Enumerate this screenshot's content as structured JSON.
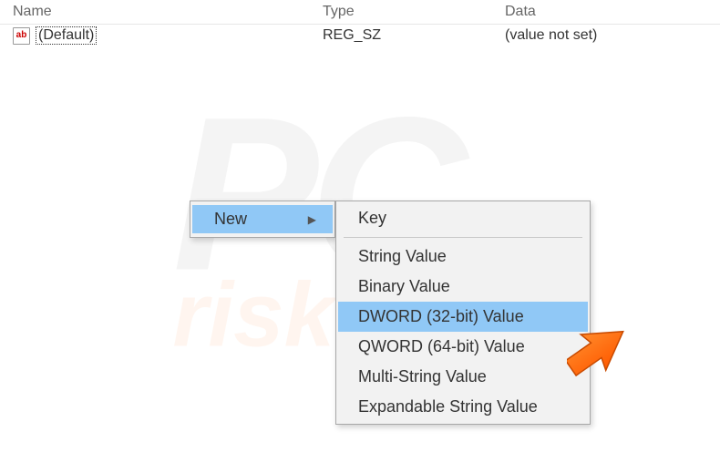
{
  "columns": {
    "name": "Name",
    "type": "Type",
    "data": "Data"
  },
  "rows": [
    {
      "icon_glyph": "ab",
      "name": "(Default)",
      "type": "REG_SZ",
      "data": "(value not set)"
    }
  ],
  "context_menu_parent": {
    "items": [
      {
        "label": "New",
        "has_submenu": true,
        "highlighted": true
      }
    ]
  },
  "context_menu_child": {
    "items": [
      {
        "label": "Key"
      },
      {
        "separator": true
      },
      {
        "label": "String Value"
      },
      {
        "label": "Binary Value"
      },
      {
        "label": "DWORD (32-bit) Value",
        "highlighted": true
      },
      {
        "label": "QWORD (64-bit) Value"
      },
      {
        "label": "Multi-String Value"
      },
      {
        "label": "Expandable String Value"
      }
    ]
  },
  "watermark": {
    "line1": "PC",
    "line2": "risk.com"
  }
}
